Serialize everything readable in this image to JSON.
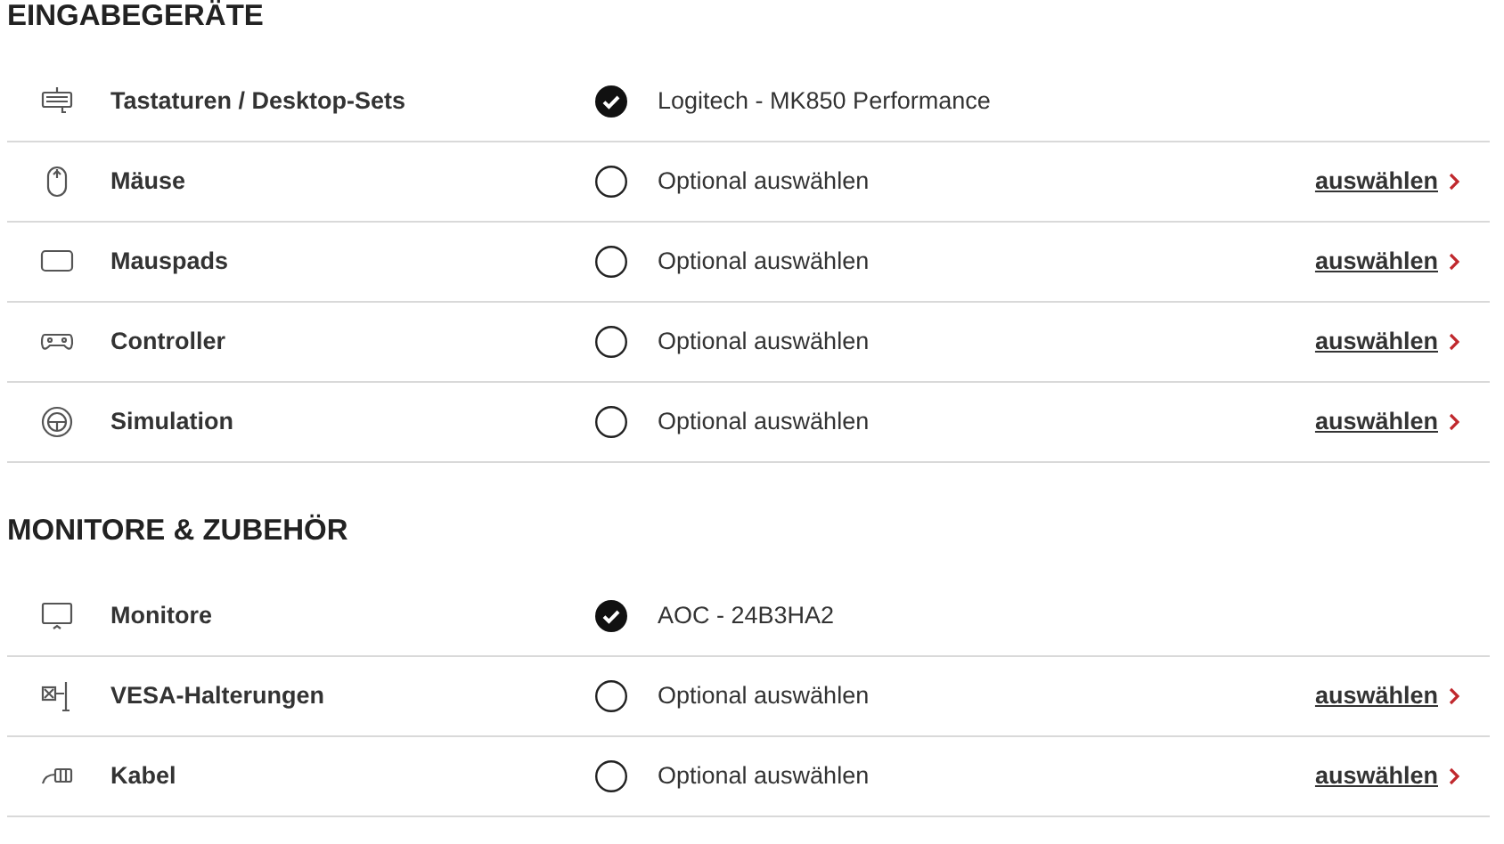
{
  "sections": [
    {
      "title": "EINGABEGERÄTE",
      "items": [
        {
          "kind": "keyboard",
          "label": "Tastaturen / Desktop-Sets",
          "checked": true,
          "value": "Logitech - MK850 Performance"
        },
        {
          "kind": "mouse",
          "label": "Mäuse",
          "checked": false,
          "value": "Optional auswählen",
          "link": "auswählen"
        },
        {
          "kind": "mousepad",
          "label": "Mauspads",
          "checked": false,
          "value": "Optional auswählen",
          "link": "auswählen"
        },
        {
          "kind": "gamepad",
          "label": "Controller",
          "checked": false,
          "value": "Optional auswählen",
          "link": "auswählen"
        },
        {
          "kind": "wheel",
          "label": "Simulation",
          "checked": false,
          "value": "Optional auswählen",
          "link": "auswählen"
        }
      ]
    },
    {
      "title": "MONITORE & ZUBEHÖR",
      "items": [
        {
          "kind": "monitor",
          "label": "Monitore",
          "checked": true,
          "value": "AOC - 24B3HA2"
        },
        {
          "kind": "mount",
          "label": "VESA-Halterungen",
          "checked": false,
          "value": "Optional auswählen",
          "link": "auswählen"
        },
        {
          "kind": "cable",
          "label": "Kabel",
          "checked": false,
          "value": "Optional auswählen",
          "link": "auswählen"
        }
      ]
    }
  ]
}
